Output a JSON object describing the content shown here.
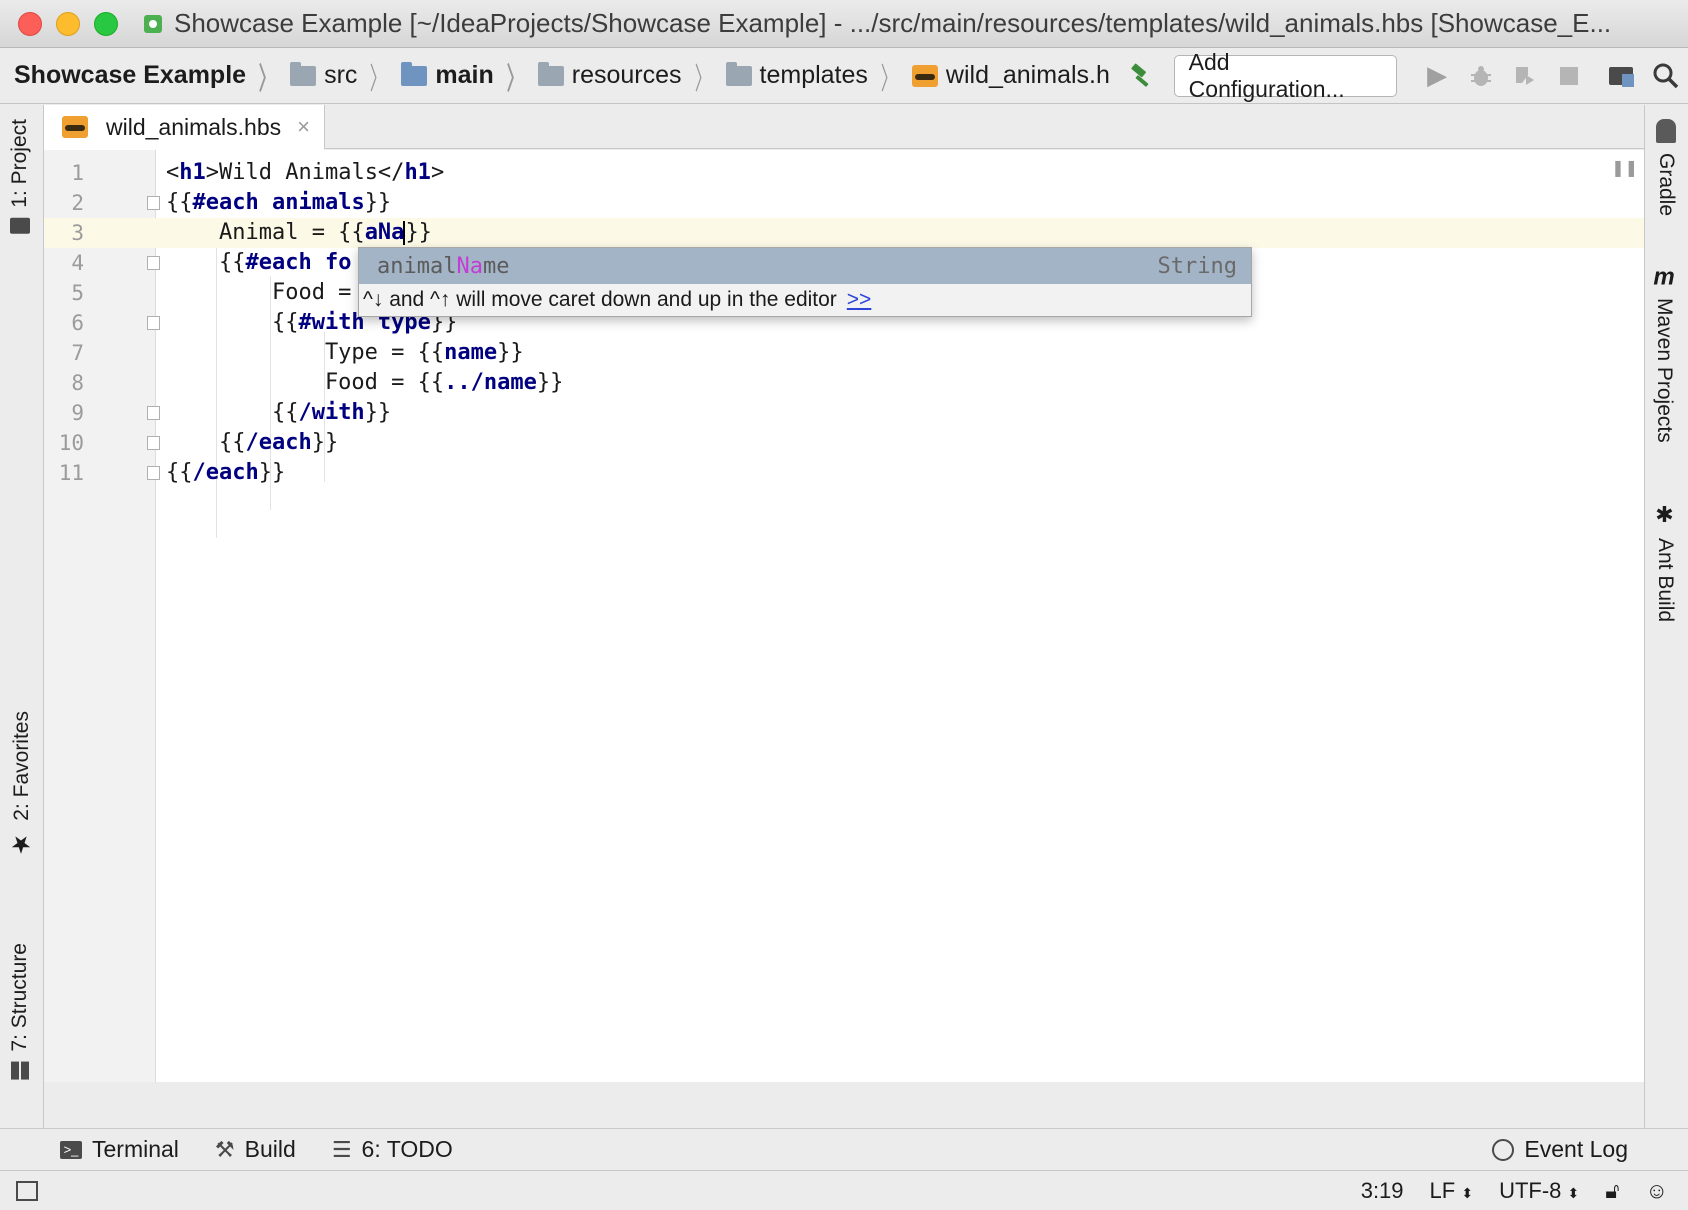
{
  "window": {
    "title": "Showcase Example [~/IdeaProjects/Showcase Example] - .../src/main/resources/templates/wild_animals.hbs [Showcase_E..."
  },
  "breadcrumbs": [
    {
      "label": "Showcase Example",
      "icon": "module-icon"
    },
    {
      "label": "src",
      "icon": "folder-icon"
    },
    {
      "label": "main",
      "icon": "folder-icon"
    },
    {
      "label": "resources",
      "icon": "resources-folder-icon"
    },
    {
      "label": "templates",
      "icon": "folder-icon"
    },
    {
      "label": "wild_animals.h",
      "icon": "handlebars-file-icon"
    }
  ],
  "toolbar": {
    "add_config_label": "Add Configuration..."
  },
  "left_tool_windows": {
    "project": "1: Project",
    "favorites": "2: Favorites",
    "structure": "7: Structure"
  },
  "right_tool_windows": {
    "gradle": "Gradle",
    "maven": "Maven Projects",
    "ant": "Ant Build"
  },
  "editor": {
    "tab_label": "wild_animals.hbs",
    "tab_close": "×",
    "line_numbers": [
      "1",
      "2",
      "3",
      "4",
      "5",
      "6",
      "7",
      "8",
      "9",
      "10",
      "11"
    ],
    "lines": [
      [
        "<",
        "h1",
        ">Wild Animals</",
        "h1",
        ">"
      ],
      [
        "{{",
        "#each animals",
        "}}"
      ],
      [
        "    Animal = {{",
        "aNa",
        "}}"
      ],
      [
        "    {{",
        "#each fo",
        ""
      ],
      [
        "        Food =",
        "",
        ""
      ],
      [
        "        {{",
        "#with type",
        "}}"
      ],
      [
        "            Type = {{",
        "name",
        "}}"
      ],
      [
        "            Food = {{",
        "../name",
        "}}"
      ],
      [
        "        {{",
        "/with",
        "}}"
      ],
      [
        "    {{",
        "/each",
        "}}"
      ],
      [
        "{{",
        "/each",
        "}}"
      ]
    ]
  },
  "autocomplete": {
    "item_prefix": "animal",
    "item_match": "Na",
    "item_suffix": "me",
    "item_type": "String",
    "hint": "^↓ and ^↑ will move caret down and up in the editor",
    "hint_link": ">>"
  },
  "bottom_tools": {
    "terminal": "Terminal",
    "build": "Build",
    "todo": "6: TODO",
    "event_log": "Event Log"
  },
  "status": {
    "position": "3:19",
    "line_sep": "LF",
    "encoding": "UTF-8"
  }
}
